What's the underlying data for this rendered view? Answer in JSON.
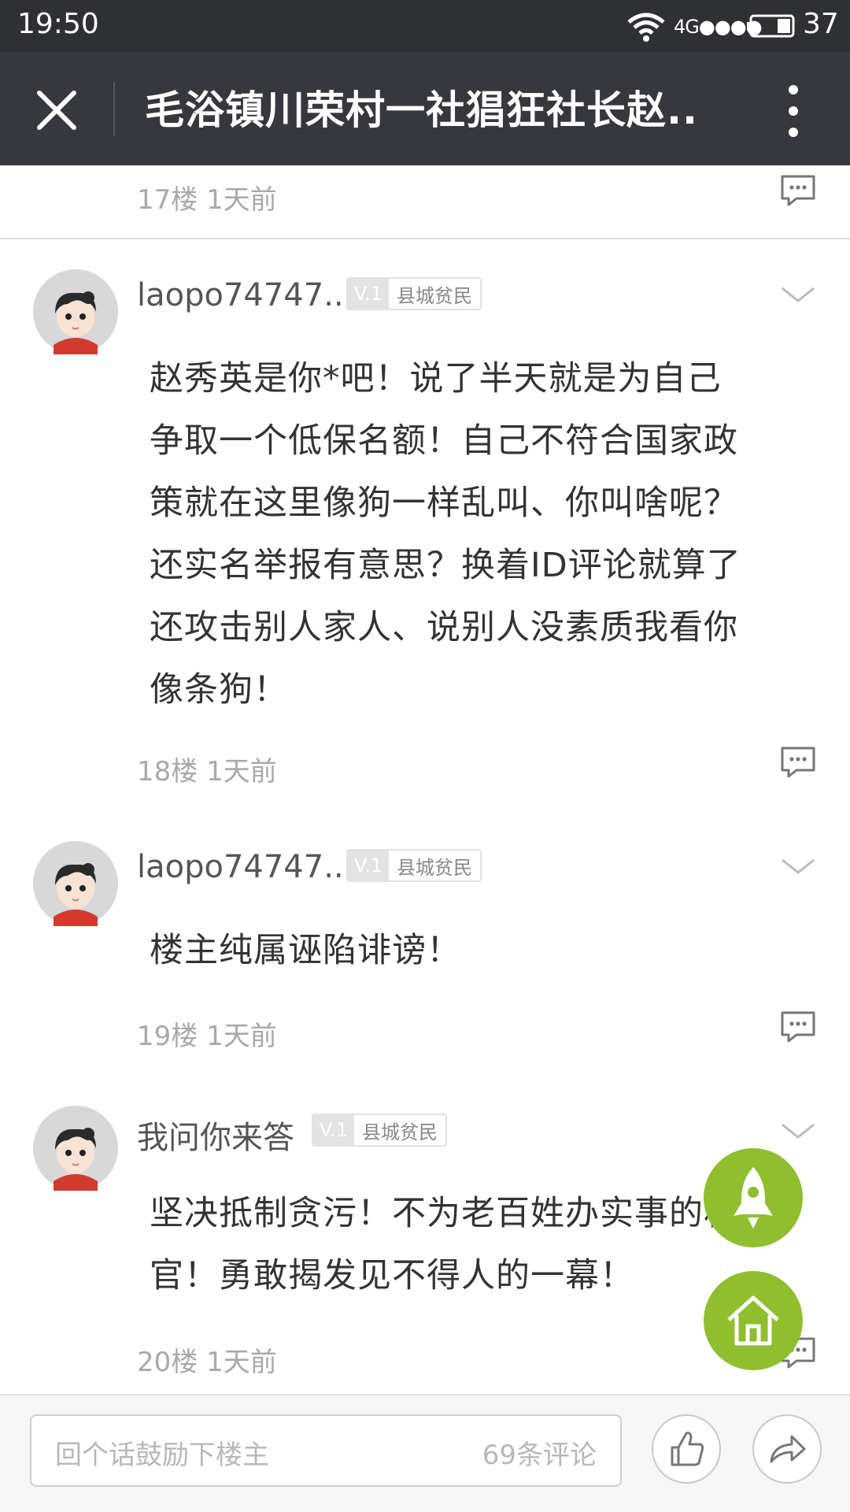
{
  "status_bar": {
    "time": "19:50",
    "network": "4G",
    "battery": "37"
  },
  "title_bar": {
    "title": "毛浴镇川荣村一社猖狂社长赵.."
  },
  "comments": [
    {
      "meta": "17楼 1天前"
    },
    {
      "username": "laopo74747...",
      "level": "V.1",
      "rank": "县城贫民",
      "lines": [
        "赵秀英是你*吧！说了半天就是为自己",
        "争取一个低保名额！自己不符合国家政",
        "策就在这里像狗一样乱叫、你叫啥呢？",
        "还实名举报有意思？换着ID评论就算了",
        "还攻击别人家人、说别人没素质我看你",
        "像条狗！"
      ],
      "meta": "18楼 1天前"
    },
    {
      "username": "laopo74747...",
      "level": "V.1",
      "rank": "县城贫民",
      "lines": [
        "楼主纯属诬陷诽谤！"
      ],
      "meta": "19楼 1天前"
    },
    {
      "username": "我问你来答",
      "level": "V.1",
      "rank": "县城贫民",
      "lines": [
        "坚决抵制贪污！不为老百姓办实事的村",
        "官！勇敢揭发见不得人的一幕！"
      ],
      "meta": "20楼 1天前"
    }
  ],
  "bottom_bar": {
    "placeholder": "回个话鼓励下楼主",
    "comment_count": "69条评论"
  },
  "colors": {
    "status_bg": "#2f3034",
    "titlebar_bg": "#37383d",
    "fab_green": "#8fbf2e",
    "meta_gray": "#a9a9a9"
  }
}
